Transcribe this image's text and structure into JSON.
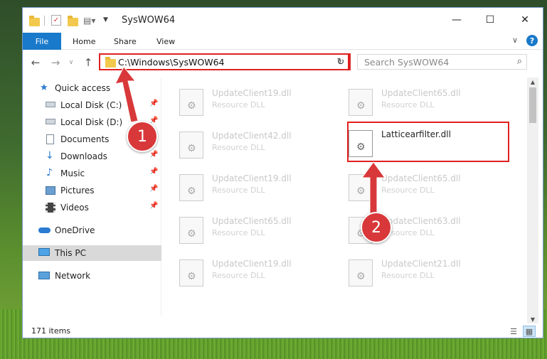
{
  "window": {
    "title": "SysWOW64",
    "minimize_glyph": "—",
    "maximize_glyph": "☐",
    "close_glyph": "✕"
  },
  "ribbon": {
    "file_tab": "File",
    "tabs": [
      "Home",
      "Share",
      "View"
    ],
    "chevron_glyph": "∨",
    "help_glyph": "?"
  },
  "navigation": {
    "back_glyph": "←",
    "forward_glyph": "→",
    "recent_glyph": "∨",
    "up_glyph": "↑",
    "address": "C:\\Windows\\SysWOW64",
    "address_drop_glyph": "∨",
    "refresh_glyph": "↻",
    "search_placeholder": "Search SysWOW64",
    "search_glyph": "⌕"
  },
  "sidebar": {
    "items": [
      {
        "label": "Quick access",
        "icon": "star-icon",
        "pinned": false
      },
      {
        "label": "Local Disk (C:)",
        "icon": "drive-icon",
        "pinned": true
      },
      {
        "label": "Local Disk (D:)",
        "icon": "drive-icon",
        "pinned": true
      },
      {
        "label": "Documents",
        "icon": "document-icon",
        "pinned": true
      },
      {
        "label": "Downloads",
        "icon": "download-icon",
        "pinned": true
      },
      {
        "label": "Music",
        "icon": "music-icon",
        "pinned": true
      },
      {
        "label": "Pictures",
        "icon": "picture-icon",
        "pinned": true
      },
      {
        "label": "Videos",
        "icon": "video-icon",
        "pinned": true
      },
      {
        "label": "OneDrive",
        "icon": "cloud-icon",
        "pinned": false
      },
      {
        "label": "This PC",
        "icon": "computer-icon",
        "pinned": false,
        "selected": true
      },
      {
        "label": "Network",
        "icon": "network-icon",
        "pinned": false
      }
    ],
    "pin_glyph": "📌"
  },
  "files": [
    {
      "name": "UpdateClient19.dll",
      "type": "Resource DLL"
    },
    {
      "name": "UpdateClient65.dll",
      "type": "Resource DLL"
    },
    {
      "name": "UpdateClient42.dll",
      "type": "Resource DLL"
    },
    {
      "name": "Latticearfilter.dll",
      "type": "",
      "highlighted": true
    },
    {
      "name": "UpdateClient19.dll",
      "type": "Resource DLL"
    },
    {
      "name": "UpdateClient65.dll",
      "type": "Resource DLL"
    },
    {
      "name": "UpdateClient65.dll",
      "type": "Resource DLL"
    },
    {
      "name": "UpdateClient63.dll",
      "type": "Resource DLL"
    },
    {
      "name": "UpdateClient19.dll",
      "type": "Resource DLL"
    },
    {
      "name": "UpdateClient21.dll",
      "type": "Resource DLL"
    }
  ],
  "status": {
    "item_count": "171 items",
    "details_view_glyph": "☰",
    "tiles_view_glyph": "▦"
  },
  "annotations": {
    "step1": "1",
    "step2": "2",
    "accent_color": "#e02020",
    "badge_color": "#d8383a"
  },
  "colors": {
    "file_tab": "#1979ca",
    "selected_nav": "#d9d9d9"
  }
}
